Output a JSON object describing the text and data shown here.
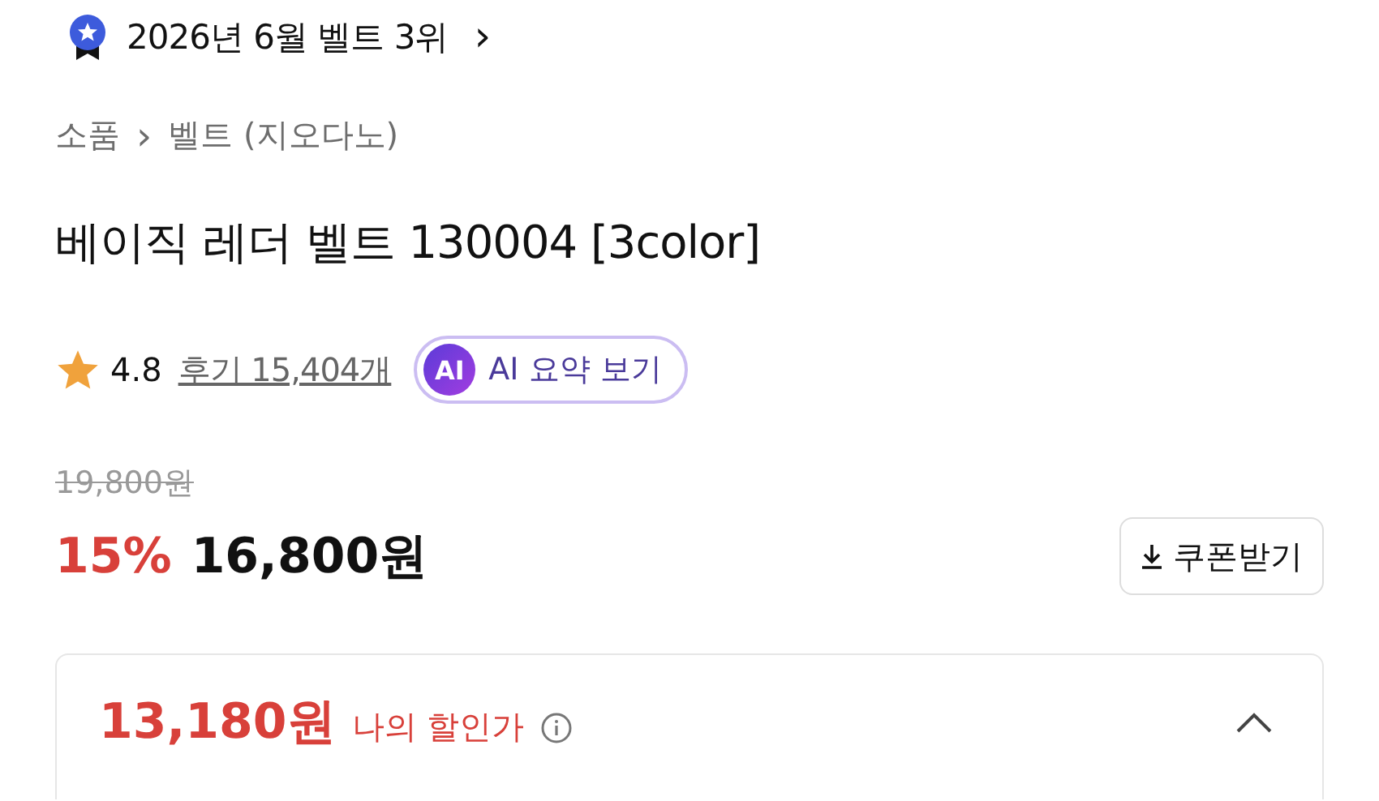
{
  "rank_banner": {
    "text": "2026년 6월 벨트 3위",
    "arrow": "›"
  },
  "breadcrumb": [
    {
      "label": "소품"
    },
    {
      "label": "벨트 (지오다노)"
    }
  ],
  "breadcrumb_separator": "›",
  "title": "베이직 레더 벨트 130004 [3color]",
  "rating": {
    "score": "4.8",
    "reviews": "후기 15,404개"
  },
  "ai_summary": {
    "badge": "AI",
    "label": "AI 요약 보기"
  },
  "price": {
    "original": "19,800원",
    "discount": "15%",
    "sale": "16,800원"
  },
  "coupon_button": {
    "label": "쿠폰받기"
  },
  "my_price": {
    "amount": "13,180원",
    "label": "나의 할인가",
    "expanded": true
  }
}
